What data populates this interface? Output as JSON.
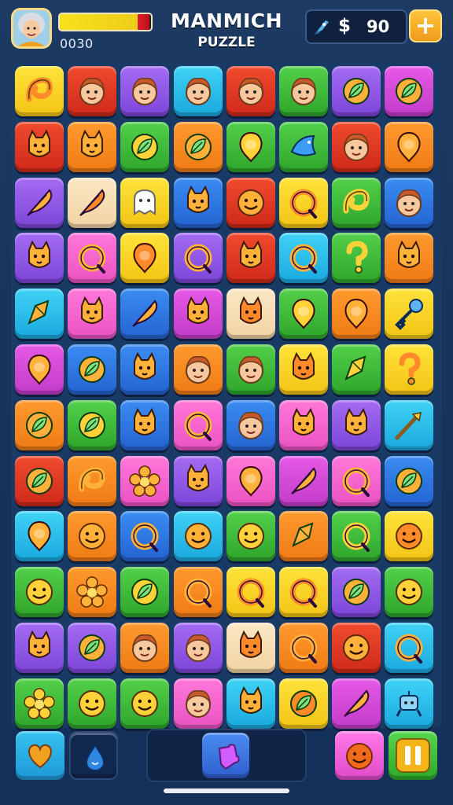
{
  "header": {
    "title": "MANMICH",
    "subtitle": "PUZZLE",
    "score": "0030",
    "currency_symbol": "$",
    "coins": "90",
    "add_label": "+",
    "health_fraction": 0.85,
    "wallet_icon": "rocket-icon",
    "avatar_icon": "grandma-avatar"
  },
  "board": {
    "rows": 12,
    "cols": 8,
    "tiles": [
      [
        "yellow:swirl",
        "red:face",
        "purple:face",
        "cyan:face",
        "red:face",
        "green:face",
        "purple:leaf",
        "magenta:leaf"
      ],
      [
        "red:cat",
        "orange:cat",
        "green:leaf",
        "orange:leaf",
        "green:balloon",
        "green:bird",
        "red:face",
        "orange:balloon"
      ],
      [
        "purple:feather",
        "cream:feather",
        "yellow:ghost",
        "blue:cat",
        "red:smile",
        "yellow:ring",
        "green:swirl",
        "blue:face"
      ],
      [
        "purple:cat",
        "pink:ring",
        "yellow:balloon",
        "purple:ring",
        "red:cat",
        "cyan:ring",
        "green:question",
        "orange:cat"
      ],
      [
        "cyan:gem",
        "pink:cat",
        "blue:feather",
        "magenta:cat",
        "cream:cat",
        "green:balloon",
        "orange:balloon",
        "yellow:key"
      ],
      [
        "magenta:balloon",
        "blue:leaf",
        "blue:cat",
        "orange:face",
        "green:face",
        "yellow:cat",
        "green:gem",
        "yellow:question"
      ],
      [
        "orange:leaf",
        "green:leaf",
        "blue:cat",
        "pink:ring",
        "blue:face",
        "pink:cat",
        "purple:cat",
        "cyan:wand"
      ],
      [
        "red:leaf",
        "orange:swirl",
        "pink:flower",
        "purple:cat",
        "pink:balloon",
        "magenta:feather",
        "pink:ring",
        "blue:leaf"
      ],
      [
        "cyan:balloon",
        "orange:smile",
        "blue:ring",
        "cyan:smile",
        "green:smile",
        "orange:gem",
        "green:ring",
        "yellow:smile"
      ],
      [
        "green:smile",
        "orange:flower",
        "green:leaf",
        "orange:ring",
        "yellow:ring",
        "yellow:ring",
        "purple:leaf",
        "green:smile"
      ],
      [
        "purple:cat",
        "purple:leaf",
        "orange:face",
        "purple:face",
        "cream:cat",
        "orange:ring",
        "red:smile",
        "cyan:ring"
      ],
      [
        "green:flower",
        "green:smile",
        "green:smile",
        "pink:face",
        "cyan:cat",
        "yellow:leaf",
        "magenta:feather",
        "cyan:robot"
      ]
    ]
  },
  "bottom": {
    "left_1": "heart-icon",
    "left_2": "drop-icon",
    "center": "puzzle-piece-icon",
    "right_1": "smile-icon",
    "pause_label": "II"
  }
}
